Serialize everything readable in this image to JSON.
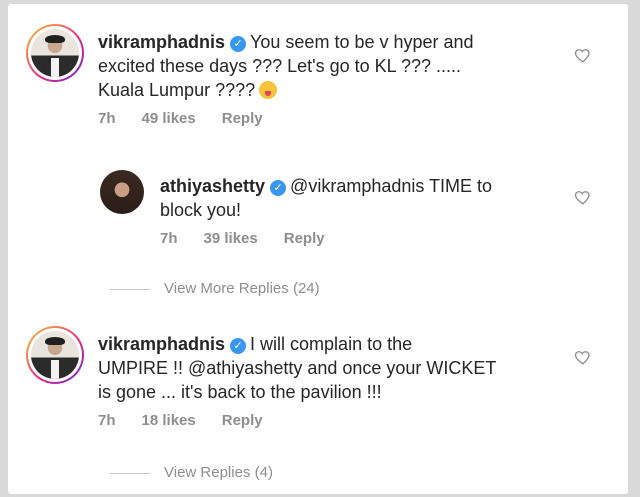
{
  "comments": [
    {
      "username": "vikramphadnis",
      "text_line1": "You seem to be v hyper and",
      "text_line2": "excited these days ??? Let's go to KL ??? .....",
      "text_line3": "Kuala Lumpur ????",
      "time": "7h",
      "likes": "49 likes",
      "reply": "Reply",
      "emoji": "tongue-out-face"
    },
    {
      "username": "athiyashetty",
      "text_line1": "@vikramphadnis TIME to",
      "text_line2": "block you!",
      "time": "7h",
      "likes": "39 likes",
      "reply": "Reply"
    },
    {
      "username": "vikramphadnis",
      "text_line1": "I will complain to the",
      "text_line2": "UMPIRE !! @athiyashetty and once your WICKET",
      "text_line3": "is gone ... it's back to the pavilion !!!",
      "time": "7h",
      "likes": "18 likes",
      "reply": "Reply"
    }
  ],
  "view_more_replies": "View More Replies (24)",
  "view_replies": "View Replies (4)",
  "colors": {
    "verified": "#3897f0",
    "meta": "#8e8e8e",
    "text": "#262626"
  }
}
